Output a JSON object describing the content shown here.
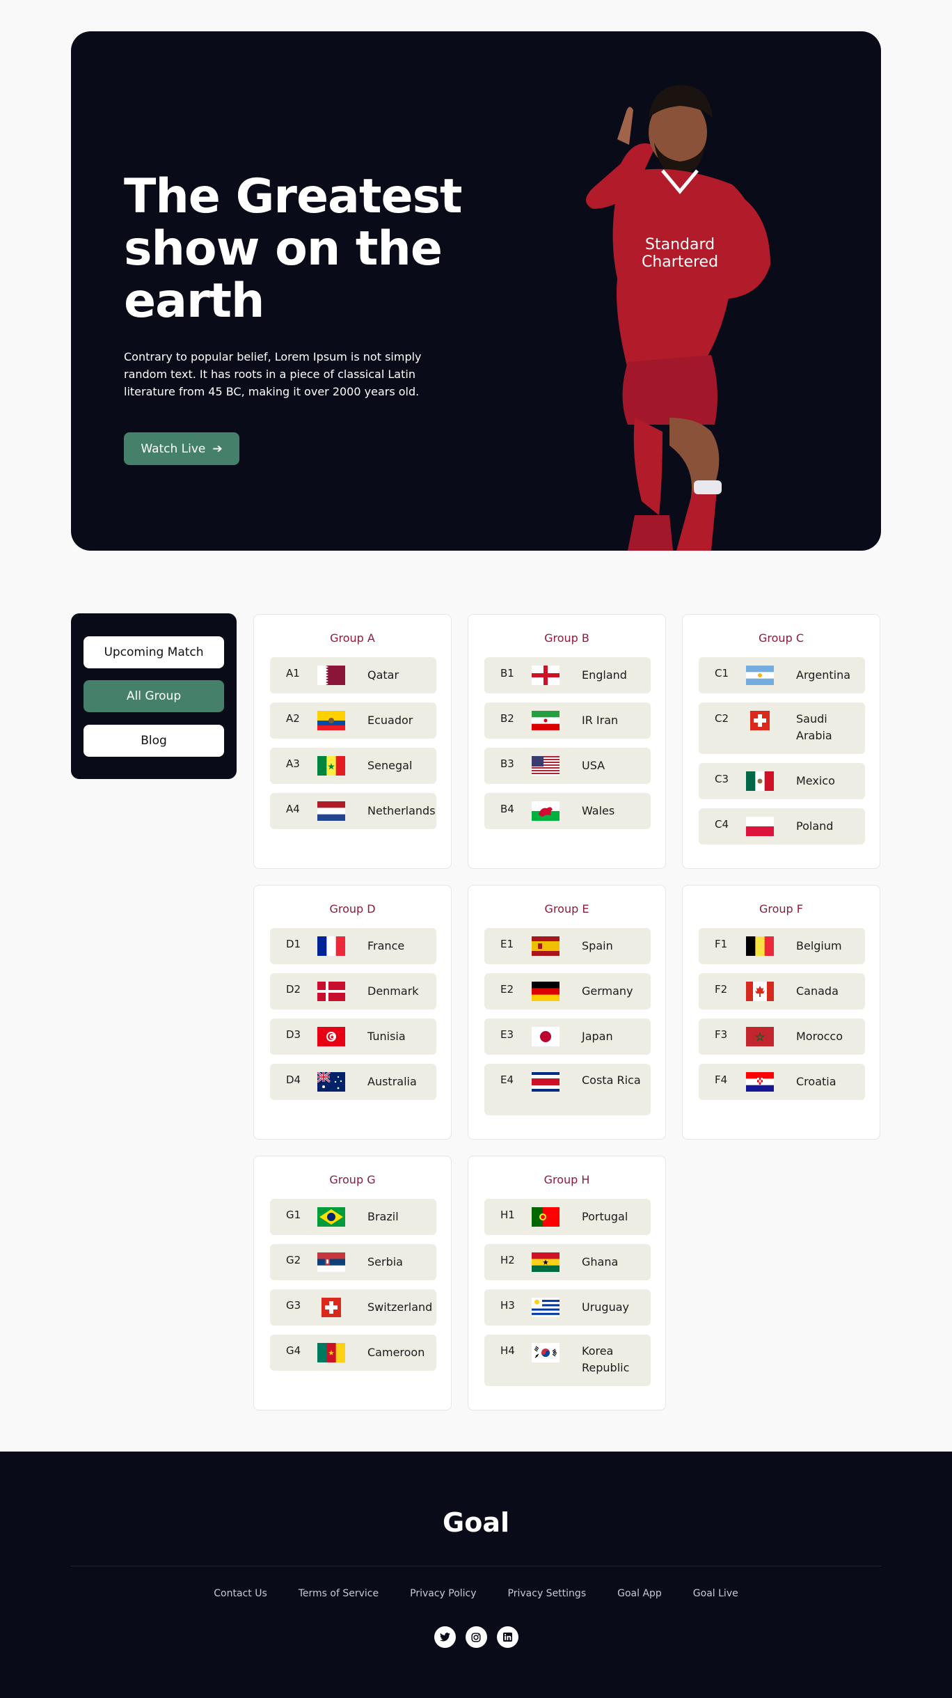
{
  "hero": {
    "title": "The Greatest show on the earth",
    "text": "Contrary to popular belief, Lorem Ipsum is not simply random text. It has roots in a piece of classical Latin literature from 45 BC, making it over 2000 years old.",
    "button_label": "Watch Live",
    "button_icon": "arrow-right-icon"
  },
  "sidebar": {
    "items": [
      {
        "label": "Upcoming Match",
        "active": false
      },
      {
        "label": "All Group",
        "active": true
      },
      {
        "label": "Blog",
        "active": false
      }
    ]
  },
  "groups": [
    {
      "title": "Group A",
      "teams": [
        {
          "pos": "A1",
          "name": "Qatar",
          "flag": "qatar"
        },
        {
          "pos": "A2",
          "name": "Ecuador",
          "flag": "ecuador"
        },
        {
          "pos": "A3",
          "name": "Senegal",
          "flag": "senegal"
        },
        {
          "pos": "A4",
          "name": "Netherlands",
          "flag": "netherlands"
        }
      ]
    },
    {
      "title": "Group B",
      "teams": [
        {
          "pos": "B1",
          "name": "England",
          "flag": "england"
        },
        {
          "pos": "B2",
          "name": "IR Iran",
          "flag": "iran"
        },
        {
          "pos": "B3",
          "name": "USA",
          "flag": "usa"
        },
        {
          "pos": "B4",
          "name": "Wales",
          "flag": "wales"
        }
      ]
    },
    {
      "title": "Group C",
      "teams": [
        {
          "pos": "C1",
          "name": "Argentina",
          "flag": "argentina"
        },
        {
          "pos": "C2",
          "name": "Saudi Arabia",
          "flag": "switzerland"
        },
        {
          "pos": "C3",
          "name": "Mexico",
          "flag": "mexico"
        },
        {
          "pos": "C4",
          "name": "Poland",
          "flag": "poland"
        }
      ]
    },
    {
      "title": "Group D",
      "teams": [
        {
          "pos": "D1",
          "name": "France",
          "flag": "france"
        },
        {
          "pos": "D2",
          "name": "Denmark",
          "flag": "denmark"
        },
        {
          "pos": "D3",
          "name": "Tunisia",
          "flag": "tunisia"
        },
        {
          "pos": "D4",
          "name": "Australia",
          "flag": "australia"
        }
      ]
    },
    {
      "title": "Group E",
      "teams": [
        {
          "pos": "E1",
          "name": "Spain",
          "flag": "spain"
        },
        {
          "pos": "E2",
          "name": "Germany",
          "flag": "germany"
        },
        {
          "pos": "E3",
          "name": "Japan",
          "flag": "japan"
        },
        {
          "pos": "E4",
          "name": "Costa Rica",
          "flag": "costarica"
        }
      ]
    },
    {
      "title": "Group F",
      "teams": [
        {
          "pos": "F1",
          "name": "Belgium",
          "flag": "belgium"
        },
        {
          "pos": "F2",
          "name": "Canada",
          "flag": "canada"
        },
        {
          "pos": "F3",
          "name": "Morocco",
          "flag": "morocco"
        },
        {
          "pos": "F4",
          "name": "Croatia",
          "flag": "croatia"
        }
      ]
    },
    {
      "title": "Group G",
      "teams": [
        {
          "pos": "G1",
          "name": "Brazil",
          "flag": "brazil"
        },
        {
          "pos": "G2",
          "name": "Serbia",
          "flag": "serbia"
        },
        {
          "pos": "G3",
          "name": "Switzerland",
          "flag": "switzerland"
        },
        {
          "pos": "G4",
          "name": "Cameroon",
          "flag": "cameroon"
        }
      ]
    },
    {
      "title": "Group H",
      "teams": [
        {
          "pos": "H1",
          "name": "Portugal",
          "flag": "portugal"
        },
        {
          "pos": "H2",
          "name": "Ghana",
          "flag": "ghana"
        },
        {
          "pos": "H3",
          "name": "Uruguay",
          "flag": "uruguay"
        },
        {
          "pos": "H4",
          "name": "Korea Republic",
          "flag": "korea"
        }
      ]
    }
  ],
  "footer": {
    "logo": "Goal",
    "links": [
      "Contact Us",
      "Terms of Service",
      "Privacy Policy",
      "Privacy Settings",
      "Goal App",
      "Goal Live"
    ],
    "socials": [
      "twitter-icon",
      "instagram-icon",
      "linkedin-icon"
    ]
  },
  "colors": {
    "dark": "#0a0b19",
    "accent": "#44806a",
    "group_title": "#8a1c3a",
    "team_bg": "#eeede4"
  }
}
